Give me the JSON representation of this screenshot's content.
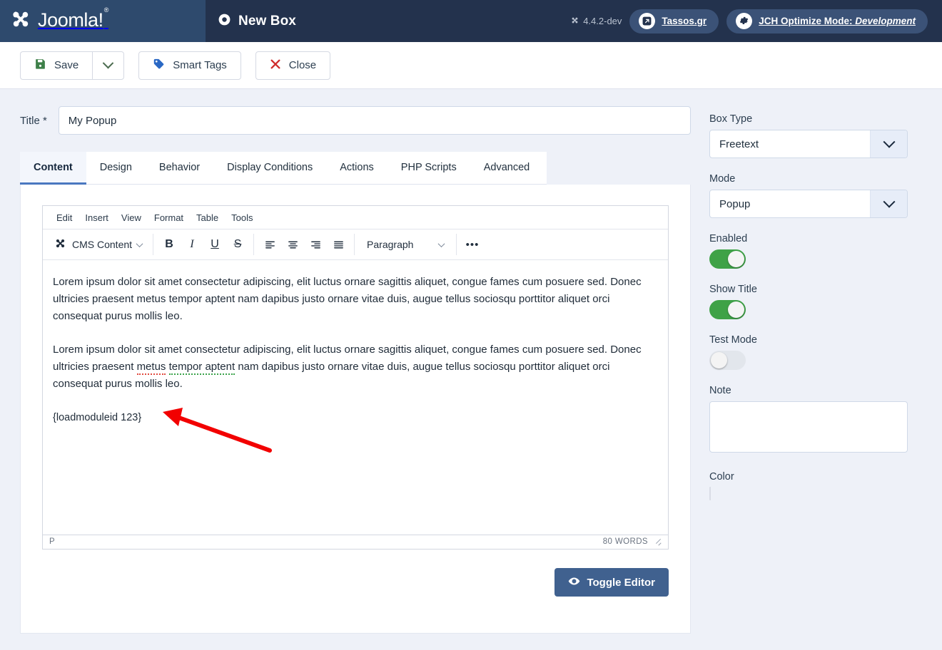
{
  "header": {
    "brand": "Joomla!",
    "brand_sup": "®",
    "page_title": "New Box",
    "page_title_icon": "dot-circle-icon",
    "version": "4.4.2-dev",
    "version_icon": "joomla-mark-icon",
    "pills": [
      {
        "label": "Tassos.gr",
        "icon": "external-link-icon"
      },
      {
        "label": "JCH Optimize Mode:",
        "emphasis": "Development",
        "icon": "gear-icon"
      }
    ]
  },
  "toolbar": {
    "save_label": "Save",
    "save_icon": "floppy-disk-icon",
    "save_dropdown_icon": "chevron-down-icon",
    "smart_tags_label": "Smart Tags",
    "smart_tags_icon": "tag-icon",
    "close_label": "Close",
    "close_icon": "x-icon"
  },
  "form": {
    "title_label": "Title *",
    "title_value": "My Popup",
    "title_placeholder": ""
  },
  "tabs": [
    {
      "label": "Content",
      "active": true
    },
    {
      "label": "Design",
      "active": false
    },
    {
      "label": "Behavior",
      "active": false
    },
    {
      "label": "Display Conditions",
      "active": false
    },
    {
      "label": "Actions",
      "active": false
    },
    {
      "label": "PHP Scripts",
      "active": false
    },
    {
      "label": "Advanced",
      "active": false
    }
  ],
  "editor": {
    "menubar": [
      "Edit",
      "Insert",
      "View",
      "Format",
      "Table",
      "Tools"
    ],
    "cms_content_label": "CMS Content",
    "cms_content_icon": "joomla-mark-icon",
    "format_buttons": [
      {
        "name": "bold-button",
        "glyph": "B"
      },
      {
        "name": "italic-button",
        "glyph": "I"
      },
      {
        "name": "underline-button",
        "glyph": "U"
      },
      {
        "name": "strikethrough-button",
        "glyph": "S"
      }
    ],
    "align_buttons": [
      "align-left-icon",
      "align-center-icon",
      "align-right-icon",
      "align-justify-icon"
    ],
    "block_format": "Paragraph",
    "more_label": "•••",
    "body": {
      "paragraph_1": "Lorem ipsum dolor sit amet consectetur adipiscing, elit luctus ornare sagittis aliquet, congue fames cum posuere sed. Donec ultricies praesent metus tempor aptent nam dapibus justo ornare vitae duis, augue tellus sociosqu porttitor aliquet orci consequat purus mollis leo.",
      "paragraph_2_pre": "Lorem ipsum dolor sit amet consectetur adipiscing, elit luctus ornare sagittis aliquet, congue fames cum posuere sed. Donec ultricies praesent ",
      "paragraph_2_misspell_red": "metus",
      "paragraph_2_mid": " ",
      "paragraph_2_misspell_green": "tempor aptent",
      "paragraph_2_post": " nam dapibus justo ornare vitae duis, augue tellus sociosqu porttitor aliquet orci consequat purus mollis leo.",
      "paragraph_3": "{loadmoduleid 123}"
    },
    "status_path": "P",
    "status_wordcount": "80 WORDS"
  },
  "toggle_editor": {
    "label": "Toggle Editor",
    "icon": "eye-icon"
  },
  "sidebar": {
    "box_type": {
      "label": "Box Type",
      "value": "Freetext"
    },
    "mode": {
      "label": "Mode",
      "value": "Popup"
    },
    "enabled": {
      "label": "Enabled",
      "state": "on"
    },
    "show_title": {
      "label": "Show Title",
      "state": "on"
    },
    "test_mode": {
      "label": "Test Mode",
      "state": "off"
    },
    "note": {
      "label": "Note",
      "value": "",
      "placeholder": ""
    },
    "color": {
      "label": "Color",
      "value": "transparent"
    }
  },
  "annotation": {
    "type": "arrow",
    "color": "#f20000",
    "points_to": "{loadmoduleid 123}"
  },
  "colors": {
    "header_bg": "#23324d",
    "logo_bg": "#2e4a6d",
    "page_bg": "#eef1f8",
    "accent_blue": "#4a78c0",
    "toggle_btn": "#40618f",
    "switch_on": "#3fa247",
    "save_icon": "#3e8049",
    "tag_icon": "#2a68c4",
    "close_icon": "#cf2c2c",
    "annotation_red": "#f20000"
  }
}
